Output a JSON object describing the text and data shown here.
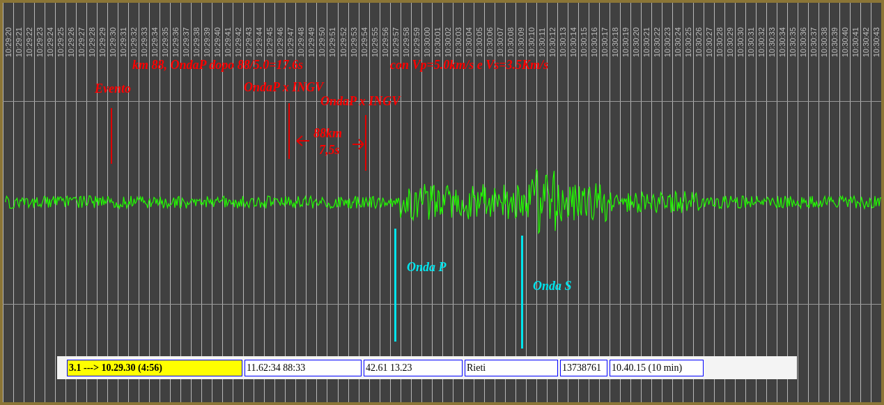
{
  "time_axis": {
    "labels": [
      "10:29:20",
      "10:29:21",
      "10:29:22",
      "10:29:23",
      "10:29:24",
      "10:29:25",
      "10:29:26",
      "10:29:27",
      "10:29:28",
      "10:29:29",
      "10:29:30",
      "10:29:31",
      "10:29:32",
      "10:29:33",
      "10:29:34",
      "10:29:35",
      "10:29:36",
      "10:29:37",
      "10:29:38",
      "10:29:39",
      "10:29:40",
      "10:29:41",
      "10:29:42",
      "10:29:43",
      "10:29:44",
      "10:29:45",
      "10:29:46",
      "10:29:47",
      "10:29:48",
      "10:29:49",
      "10:29:50",
      "10:29:51",
      "10:29:52",
      "10:29:53",
      "10:29:54",
      "10:29:55",
      "10:29:56",
      "10:29:57",
      "10:29:58",
      "10:29:59",
      "10:30:00",
      "10:30:01",
      "10:30:02",
      "10:30:03",
      "10:30:04",
      "10:30:05",
      "10:30:06",
      "10:30:07",
      "10:30:08",
      "10:30:09",
      "10:30:10",
      "10:30:11",
      "10:30:12",
      "10:30:13",
      "10:30:14",
      "10:30:15",
      "10:30:16",
      "10:30:17",
      "10:30:18",
      "10:30:19",
      "10:30:20",
      "10:30:21",
      "10:30:22",
      "10:30:23",
      "10:30:24",
      "10:30:25",
      "10:30:26",
      "10:30:27",
      "10:30:28",
      "10:30:29",
      "10:30:30",
      "10:30:31",
      "10:30:32",
      "10:30:33",
      "10:30:34",
      "10:30:35",
      "10:30:36",
      "10:30:37",
      "10:30:38",
      "10:30:39",
      "10:30:40",
      "10:30:41",
      "10:30:42",
      "10:30:43"
    ]
  },
  "annotations": [
    {
      "text": "km 88, OndaP dopo 88/5.0=17.6s",
      "color": "#ff0000"
    },
    {
      "text": "con Vp=5.0km/s e Vs=3.5Km/s",
      "color": "#ff0000"
    },
    {
      "text": "Evento",
      "color": "#ff0000"
    },
    {
      "text": "OndaP x INGV",
      "color": "#ff0000"
    },
    {
      "text": "OndaP x INGV",
      "color": "#ff0000"
    },
    {
      "text": "88km",
      "color": "#ff0000"
    },
    {
      "text": "7,5s",
      "color": "#ff0000"
    },
    {
      "text": "Onda P",
      "color": "#00e5ee"
    },
    {
      "text": "Onda S",
      "color": "#00e5ee"
    }
  ],
  "event_table": {
    "rows": [
      {
        "cells": [
          {
            "text": "3.1 ---> 10.29.30 (4:56)",
            "highlighted": true
          },
          {
            "text": "11.62:34 88:33",
            "highlighted": false
          },
          {
            "text": "42.61 13.23",
            "highlighted": false
          },
          {
            "text": "Rieti",
            "highlighted": false
          },
          {
            "text": "13738761",
            "highlighted": false
          },
          {
            "text": "10.40.15 (10 min)",
            "highlighted": false
          }
        ]
      }
    ]
  }
}
